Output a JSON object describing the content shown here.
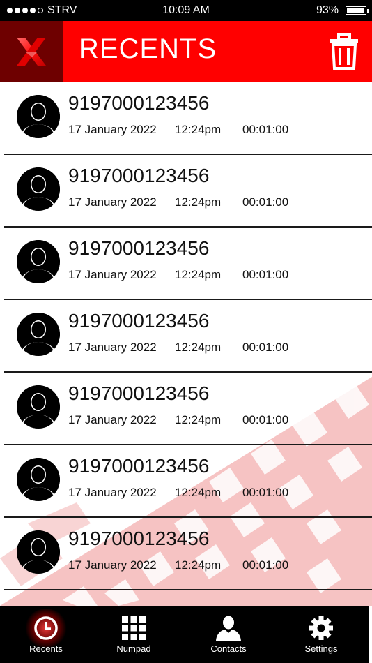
{
  "status_bar": {
    "carrier": "STRV",
    "time": "10:09 AM",
    "battery": "93%",
    "battery_level": 0.93,
    "signal_bars": 4
  },
  "header": {
    "title": "RECENTS",
    "logo_icon": "x-logo-icon",
    "delete_icon": "trash-icon"
  },
  "colors": {
    "brand_red": "#ff0000",
    "logo_bg": "#6e0000",
    "tab_bar_bg": "#000000"
  },
  "calls": [
    {
      "number": "9197000123456",
      "date": "17 January 2022",
      "time": "12:24pm",
      "duration": "00:01:00"
    },
    {
      "number": "9197000123456",
      "date": "17 January 2022",
      "time": "12:24pm",
      "duration": "00:01:00"
    },
    {
      "number": "9197000123456",
      "date": "17 January 2022",
      "time": "12:24pm",
      "duration": "00:01:00"
    },
    {
      "number": "9197000123456",
      "date": "17 January 2022",
      "time": "12:24pm",
      "duration": "00:01:00"
    },
    {
      "number": "9197000123456",
      "date": "17 January 2022",
      "time": "12:24pm",
      "duration": "00:01:00"
    },
    {
      "number": "9197000123456",
      "date": "17 January 2022",
      "time": "12:24pm",
      "duration": "00:01:00"
    },
    {
      "number": "9197000123456",
      "date": "17 January 2022",
      "time": "12:24pm",
      "duration": "00:01:00"
    }
  ],
  "tabs": [
    {
      "label": "Recents",
      "icon": "clock-icon",
      "active": true
    },
    {
      "label": "Numpad",
      "icon": "numpad-icon",
      "active": false
    },
    {
      "label": "Contacts",
      "icon": "person-icon",
      "active": false
    },
    {
      "label": "Settings",
      "icon": "gear-icon",
      "active": false
    }
  ]
}
